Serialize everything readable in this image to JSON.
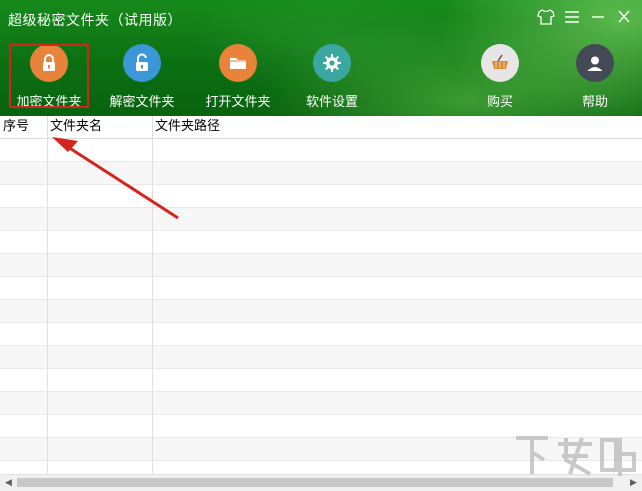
{
  "window": {
    "title": "超级秘密文件夹（试用版）",
    "controls": [
      "shirt-icon",
      "menu-icon",
      "minimize-icon",
      "close-icon"
    ]
  },
  "toolbar": {
    "encrypt": {
      "label": "加密文件夹",
      "icon": "lock-closed-icon",
      "color": "#e8833a"
    },
    "decrypt": {
      "label": "解密文件夹",
      "icon": "lock-open-icon",
      "color": "#3b97d8"
    },
    "open": {
      "label": "打开文件夹",
      "icon": "folder-icon",
      "color": "#e8833a"
    },
    "settings": {
      "label": "软件设置",
      "icon": "gear-icon",
      "color": "#3aa8a0"
    },
    "buy": {
      "label": "购买",
      "icon": "basket-icon",
      "color": "#e3e3e3"
    },
    "help": {
      "label": "帮助",
      "icon": "user-icon",
      "color": "#444a55"
    }
  },
  "table": {
    "columns": [
      "序号",
      "文件夹名",
      "文件夹路径"
    ],
    "rows": []
  },
  "watermark": {
    "text": "下载吧"
  },
  "colors": {
    "highlight": "#d4241c",
    "header_green": "#0c6f12"
  }
}
